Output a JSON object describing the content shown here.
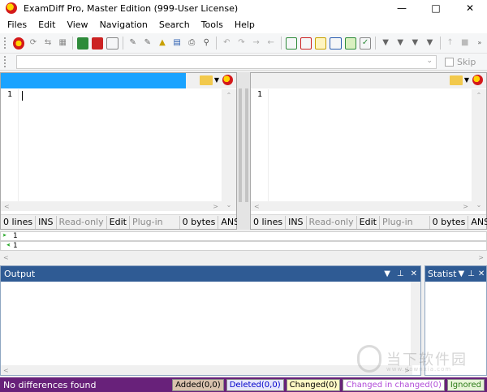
{
  "window": {
    "title": "ExamDiff Pro, Master Edition (999-User License)"
  },
  "menu": [
    "Files",
    "Edit",
    "View",
    "Navigation",
    "Search",
    "Tools",
    "Help"
  ],
  "toolbar2": {
    "skip_label": "Skip"
  },
  "left_pane": {
    "line_number": "1",
    "status": {
      "lines": "0 lines",
      "ins": "INS",
      "readonly": "Read-only",
      "edit": "Edit",
      "plugin": "Plug-in",
      "bytes": "0 bytes",
      "encoding": "ANSI"
    }
  },
  "right_pane": {
    "line_number": "1",
    "status": {
      "lines": "0 lines",
      "ins": "INS",
      "readonly": "Read-only",
      "edit": "Edit",
      "plugin": "Plug-in",
      "bytes": "0 bytes",
      "encoding": "ANSI"
    }
  },
  "line_compare": {
    "left_line": "1",
    "right_line": "1"
  },
  "output_panel": {
    "title": "Output"
  },
  "stat_panel": {
    "title": "Statist"
  },
  "watermark": {
    "text": "当下软件园",
    "url": "www.downxia.com"
  },
  "statusbar": {
    "message": "No differences found",
    "legend": [
      {
        "label": "Added(0,0)",
        "bg": "#d9c2ad",
        "fg": "#000000"
      },
      {
        "label": "Deleted(0,0)",
        "bg": "#e6e6fa",
        "fg": "#0000cc"
      },
      {
        "label": "Changed(0)",
        "bg": "#fff8c4",
        "fg": "#000000"
      },
      {
        "label": "Changed in changed(0)",
        "bg": "#ffffff",
        "fg": "#b04ad8"
      },
      {
        "label": "Ignored",
        "bg": "#e8f4d8",
        "fg": "#2e7d1a"
      }
    ]
  },
  "colors": {
    "active_path": "#1aa3ff",
    "panel_header": "#2f5b94",
    "statusbar": "#68217a"
  }
}
